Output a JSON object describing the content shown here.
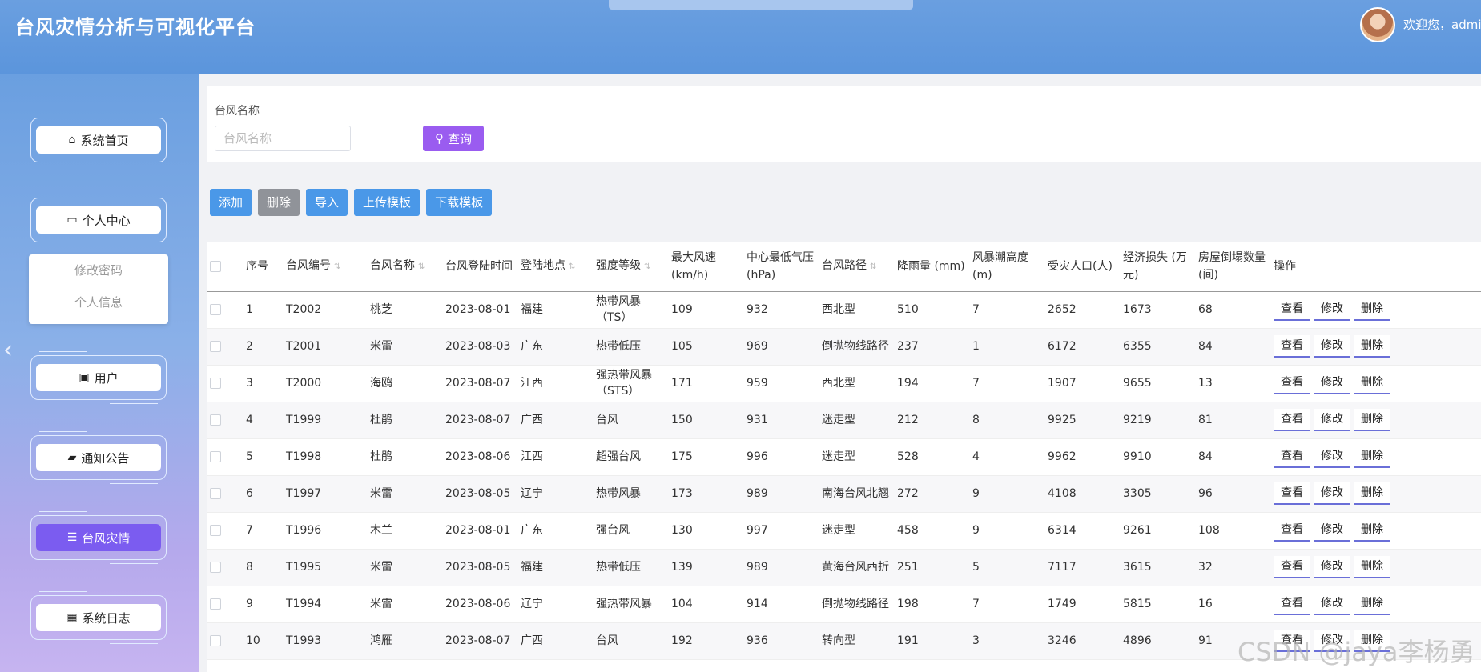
{
  "header": {
    "title": "台风灾情分析与可视化平台",
    "welcome": "欢迎您，admin"
  },
  "sidebar": {
    "items": [
      {
        "label": "系统首页",
        "icon": "home-icon",
        "glyph": "⌂"
      },
      {
        "label": "个人中心",
        "icon": "card-icon",
        "glyph": "▭"
      },
      {
        "label": "用户",
        "icon": "user-card-icon",
        "glyph": "▣"
      },
      {
        "label": "通知公告",
        "icon": "briefcase-icon",
        "glyph": "▰"
      },
      {
        "label": "台风灾情",
        "icon": "list-icon",
        "glyph": "☰"
      },
      {
        "label": "系统日志",
        "icon": "grid-icon",
        "glyph": "▦"
      }
    ],
    "submenu": [
      "修改密码",
      "个人信息"
    ],
    "active_color": "#7b5cf0"
  },
  "search": {
    "label": "台风名称",
    "placeholder": "台风名称",
    "button": "查询"
  },
  "toolbar": {
    "add": "添加",
    "delete": "删除",
    "import": "导入",
    "upload_template": "上传模板",
    "download_template": "下载模板"
  },
  "table": {
    "headers": [
      "序号",
      "台风编号",
      "台风名称",
      "台风登陆时间",
      "登陆地点",
      "强度等级",
      "最大风速 (km/h)",
      "中心最低气压(hPa)",
      "台风路径",
      "降雨量 (mm)",
      "风暴潮高度(m)",
      "受灾人口(人)",
      "经济损失 (万元)",
      "房屋倒塌数量(间)",
      "操作"
    ],
    "actions": {
      "view": "查看",
      "edit": "修改",
      "delete": "删除"
    },
    "rows": [
      [
        "1",
        "T2002",
        "桃芝",
        "2023-08-01",
        "福建",
        "热带风暴（TS）",
        "109",
        "932",
        "西北型",
        "510",
        "7",
        "2652",
        "1673",
        "68"
      ],
      [
        "2",
        "T2001",
        "米雷",
        "2023-08-03",
        "广东",
        "热带低压",
        "105",
        "969",
        "倒抛物线路径",
        "237",
        "1",
        "6172",
        "6355",
        "84"
      ],
      [
        "3",
        "T2000",
        "海鸥",
        "2023-08-07",
        "江西",
        "强热带风暴（STS）",
        "171",
        "959",
        "西北型",
        "194",
        "7",
        "1907",
        "9655",
        "13"
      ],
      [
        "4",
        "T1999",
        "杜鹃",
        "2023-08-07",
        "广西",
        "台风",
        "150",
        "931",
        "迷走型",
        "212",
        "8",
        "9925",
        "9219",
        "81"
      ],
      [
        "5",
        "T1998",
        "杜鹃",
        "2023-08-06",
        "江西",
        "超强台风",
        "175",
        "996",
        "迷走型",
        "528",
        "4",
        "9962",
        "9910",
        "84"
      ],
      [
        "6",
        "T1997",
        "米雷",
        "2023-08-05",
        "辽宁",
        "热带风暴",
        "173",
        "989",
        "南海台风北翘",
        "272",
        "9",
        "4108",
        "3305",
        "96"
      ],
      [
        "7",
        "T1996",
        "木兰",
        "2023-08-01",
        "广东",
        "强台风",
        "130",
        "997",
        "迷走型",
        "458",
        "9",
        "6314",
        "9261",
        "108"
      ],
      [
        "8",
        "T1995",
        "米雷",
        "2023-08-05",
        "福建",
        "热带低压",
        "139",
        "989",
        "黄海台风西折",
        "251",
        "5",
        "7117",
        "3615",
        "32"
      ],
      [
        "9",
        "T1994",
        "米雷",
        "2023-08-06",
        "辽宁",
        "强热带风暴",
        "104",
        "914",
        "倒抛物线路径",
        "198",
        "7",
        "1749",
        "5815",
        "16"
      ],
      [
        "10",
        "T1993",
        "鸿雁",
        "2023-08-07",
        "广西",
        "台风",
        "192",
        "936",
        "转向型",
        "191",
        "3",
        "3246",
        "4896",
        "91"
      ]
    ]
  },
  "watermark": "CSDN @jaya李杨勇"
}
